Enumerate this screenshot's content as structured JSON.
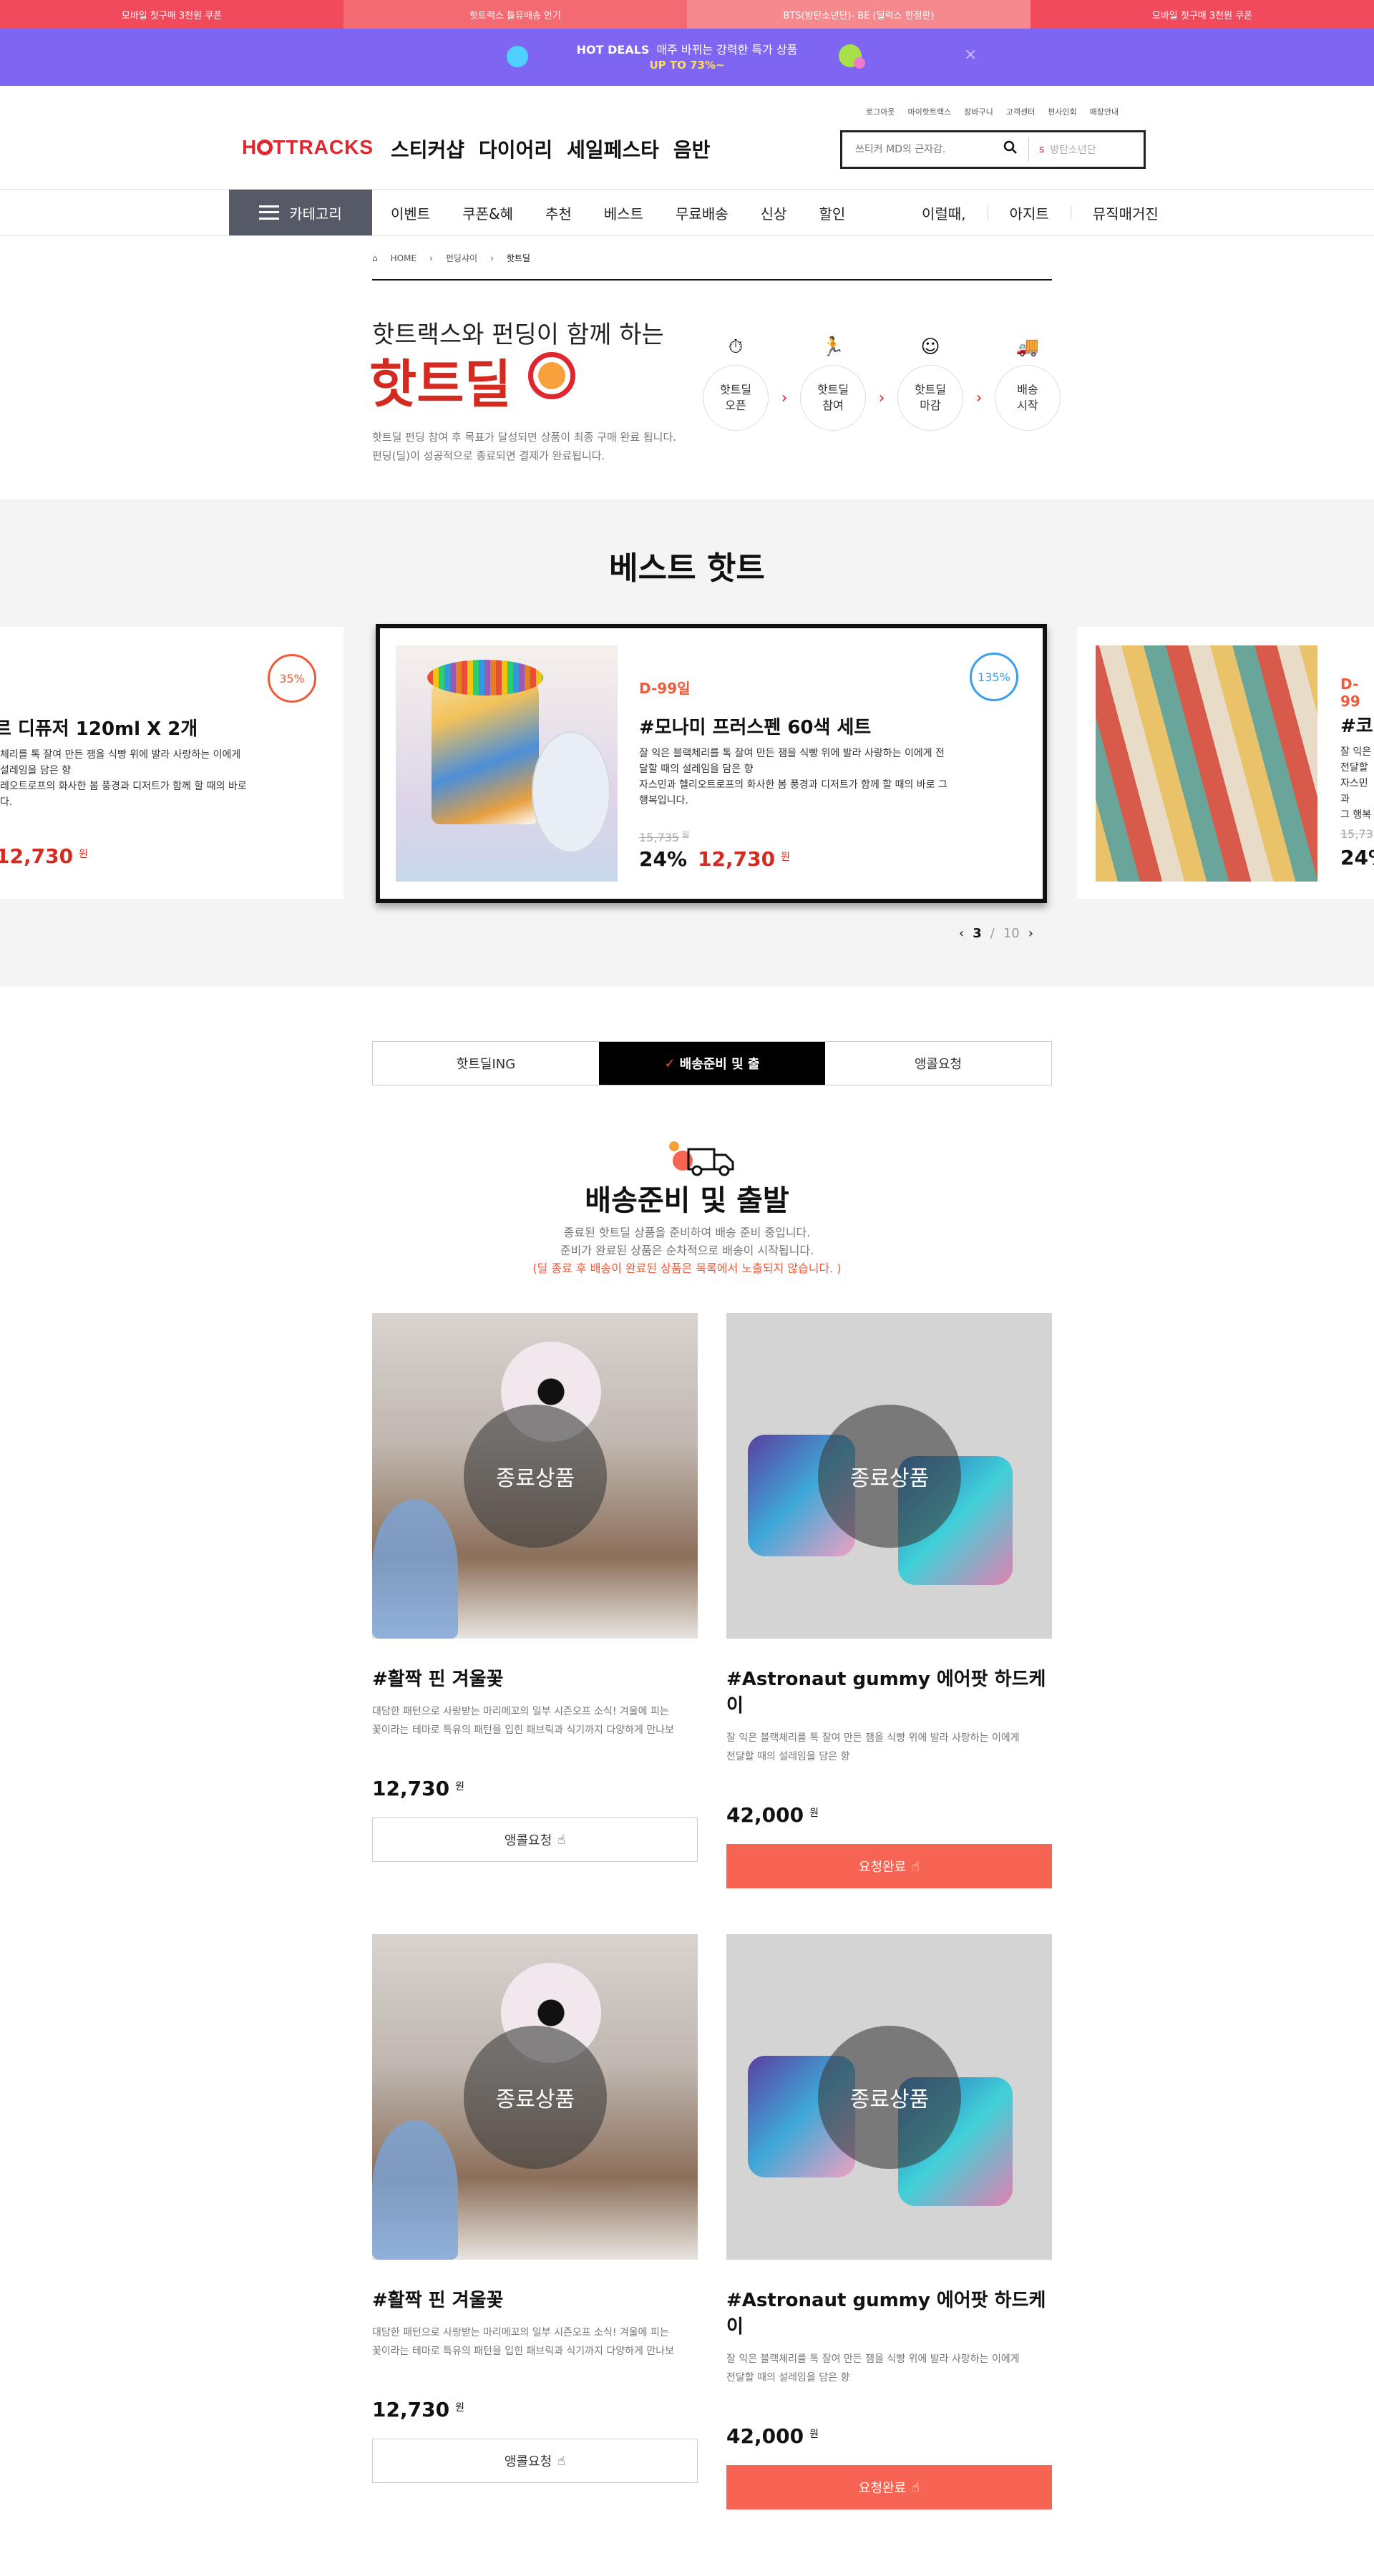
{
  "topbar": {
    "tabs": [
      "모바일 첫구매 3천원 쿠폰",
      "핫트랙스 틀뮤배송 안기",
      "BTS(방탄소년단)- BE (딜럭스 한정판)",
      "모바일 첫구매 3천원 쿠폰"
    ]
  },
  "hotdeal": {
    "title": "HOT DEALS",
    "subtitle": "매주 바뀌는 강력한 특가 상품",
    "discount": "UP TO 73%~",
    "close": "×"
  },
  "utility": [
    "로그아웃",
    "마이핫트랙스",
    "장바구니",
    "고객센터",
    "편사인회",
    "매장안내"
  ],
  "header": {
    "logo": "HOTTRACKS",
    "menu": [
      "스티커샵",
      "다이어리",
      "세일페스타",
      "음반"
    ],
    "search": {
      "placeholder": "쓰티커 MD의 근자감.",
      "keyword_icon": "s",
      "keyword": "방탄소년단"
    }
  },
  "nav": {
    "category": "카테고리",
    "items": [
      "이벤트",
      "쿠폰&혜",
      "추천",
      "베스트",
      "무료배송",
      "신상",
      "할인"
    ],
    "items2": [
      "이럴때,",
      "아지트",
      "뮤직매거진"
    ]
  },
  "breadcrumb": [
    "HOME",
    "펀딩샤이",
    "핫트딜"
  ],
  "intro": {
    "line1": "핫트랙스와 펀딩이 함께 하는",
    "line2": "핫트딜",
    "desc1": "핫트딜 펀딩 참여 후 목표가 달성되면 상품이 최종 구매 완료 됩니다.",
    "desc2": "펀딩(딜)이 성공적으로 종료되면 결제가 완료됩니다."
  },
  "steps": [
    [
      "핫트딜",
      "오픈"
    ],
    [
      "핫트딜",
      "참여"
    ],
    [
      "핫트딜",
      "마감"
    ],
    [
      "배송",
      "시작"
    ]
  ],
  "best": {
    "title": "베스트 핫트",
    "left": {
      "badge": "35%",
      "title": "르 디퓨저 120ml X 2개",
      "desc": [
        "체리를 톡 잘여 만든 잼을 식빵 위에 발라 사랑하는 이에게",
        "설레임을 담은 향",
        "레오트로프의 화사한 봄 풍경과 디저트가 함께 할 때의 바로",
        "다."
      ],
      "price": "12,730",
      "won": "원"
    },
    "main": {
      "dday": "D-99일",
      "badge": "135%",
      "title": "#모나미 프러스펜 60색 세트",
      "desc": [
        "잘 익은 블랙체리를 톡 잘여 만든 잼을 식빵 위에 발라 사랑하는 이에게 전",
        "달할 때의 설레임을 담은 향",
        "자스민과 헬리오트로프의 화사한 봄 풍경과 디저트가 함께 할 때의 바로 그",
        "행복입니다."
      ],
      "orig": "15,735",
      "orig_won": "원",
      "rate": "24%",
      "price": "12,730",
      "won": "원"
    },
    "right": {
      "dday": "D-99",
      "title": "#코",
      "desc": [
        "잘 익은",
        "전달할",
        "자스민과",
        "그 행복"
      ],
      "orig": "15,73",
      "rate": "24%"
    },
    "pager": {
      "current": "3",
      "sep": "/",
      "total": "10"
    }
  },
  "tabs": [
    "핫트딜ING",
    "배송준비 및 출",
    "앵콜요청"
  ],
  "section": {
    "title": "배송준비 및 출발",
    "desc1": "종료된 핫트딜 상품을 준비하여 배송 준비 중입니다.",
    "desc2": "준비가 완료된 상품은 순차적으로 배송이 시작됩니다.",
    "warn": "(딜 종료 후 배송이 완료된 상품은 목록에서 노출되지 않습니다. )"
  },
  "products": [
    {
      "overlay": "종료상품",
      "name": "#활짝 핀 겨울꽃",
      "desc1": "대담한 패턴으로 사랑받는 마리메꼬의 일부 시즌오프 소식! 겨울에 피는",
      "desc2": "꽃이라는 테마로 특유의 패턴을 입힌 패브릭과 식기까지 다양하게 만나보",
      "price": "12,730",
      "won": "원",
      "button": "앵콜요청"
    },
    {
      "overlay": "종료상품",
      "name": "#Astronaut gummy 에어팟 하드케이",
      "desc1": "잘 익은 블랙체리를 톡 잘여 만든 잼을 식빵 위에 발라 사랑하는 이에게",
      "desc2": "전달할 때의 설레임을 담은 향",
      "price": "42,000",
      "won": "원",
      "button": "요청완료"
    },
    {
      "overlay": "종료상품",
      "name": "#활짝 핀 겨울꽃",
      "desc1": "대담한 패턴으로 사랑받는 마리메꼬의 일부 시즌오프 소식! 겨울에 피는",
      "desc2": "꽃이라는 테마로 특유의 패턴을 입힌 패브릭과 식기까지 다양하게 만나보",
      "price": "12,730",
      "won": "원",
      "button": "앵콜요청"
    },
    {
      "overlay": "종료상품",
      "name": "#Astronaut gummy 에어팟 하드케이",
      "desc1": "잘 익은 블랙체리를 톡 잘여 만든 잼을 식빵 위에 발라 사랑하는 이에게",
      "desc2": "전달할 때의 설레임을 담은 향",
      "price": "42,000",
      "won": "원",
      "button": "요청완료"
    }
  ]
}
